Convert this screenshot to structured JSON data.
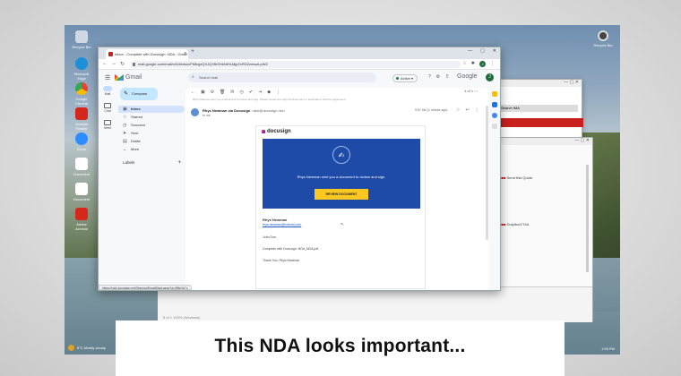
{
  "desktop": {
    "icons": [
      "Recycle Bin",
      "Microsoft Edge",
      "Google Chrome",
      "Acrobat Reader",
      "Zoom",
      "Document",
      "Document",
      "Adobe Acrobat"
    ],
    "trash_label": "Recycle Bin",
    "weather": "8°C Mostly cloudy",
    "clock": "1:05 PM"
  },
  "back_window": {
    "search_label": "Search IMA",
    "line1": "Send this Quote",
    "line2": "Duty5ucVT4A",
    "footer": "8 of 1  100% (Windows)"
  },
  "chrome": {
    "tab_title": "Inbox - Complete with Docusign: NDA - Gmail",
    "url": "mail.google.com/mail/u/0/#inbox/FMfcgzQXJQXfbSHkNtHLMjpZxRDZzmwzLpWZ",
    "status_url": "https://na4.docusign.net/Signing/EmailStart.aspx?a=0f8e1b7c"
  },
  "gmail": {
    "logo_text": "Gmail",
    "search_placeholder": "Search mail",
    "status": "Active",
    "google_text": "Google",
    "avatar_letter": "J",
    "compose_label": "Compose",
    "rail": [
      "Mail",
      "Chat",
      "Meet"
    ],
    "folders": [
      {
        "icon": "▣",
        "label": "Inbox"
      },
      {
        "icon": "☆",
        "label": "Starred"
      },
      {
        "icon": "◷",
        "label": "Snoozed"
      },
      {
        "icon": "➤",
        "label": "Sent"
      },
      {
        "icon": "▤",
        "label": "Drafts"
      },
      {
        "icon": "⌄",
        "label": "More"
      }
    ],
    "labels_heading": "Labels",
    "pager": "1 of 1",
    "snippet": "Rhys Newman sent you a document to review and sign. Please review and sign the document in accordance with the agreement."
  },
  "email": {
    "sender_name": "Rhys Newman via Docusign",
    "sender_email": "<dse@docusign.net>",
    "to_line": "to me",
    "time": "9:57 AM (1 minute ago)",
    "logo": "docusign",
    "banner_message": "Rhys Newman sent you a document to review and sign.",
    "button_label": "REVIEW DOCUMENT",
    "sig_name": "Rhys Newman",
    "sig_email": "rhys.newman@hotmail.com",
    "greeting": "John Doe,",
    "body": "Complete with Docusign: NDA_NDA.pdf",
    "closing": "Thank You, Rhys Newman"
  },
  "caption": "This NDA looks important..."
}
